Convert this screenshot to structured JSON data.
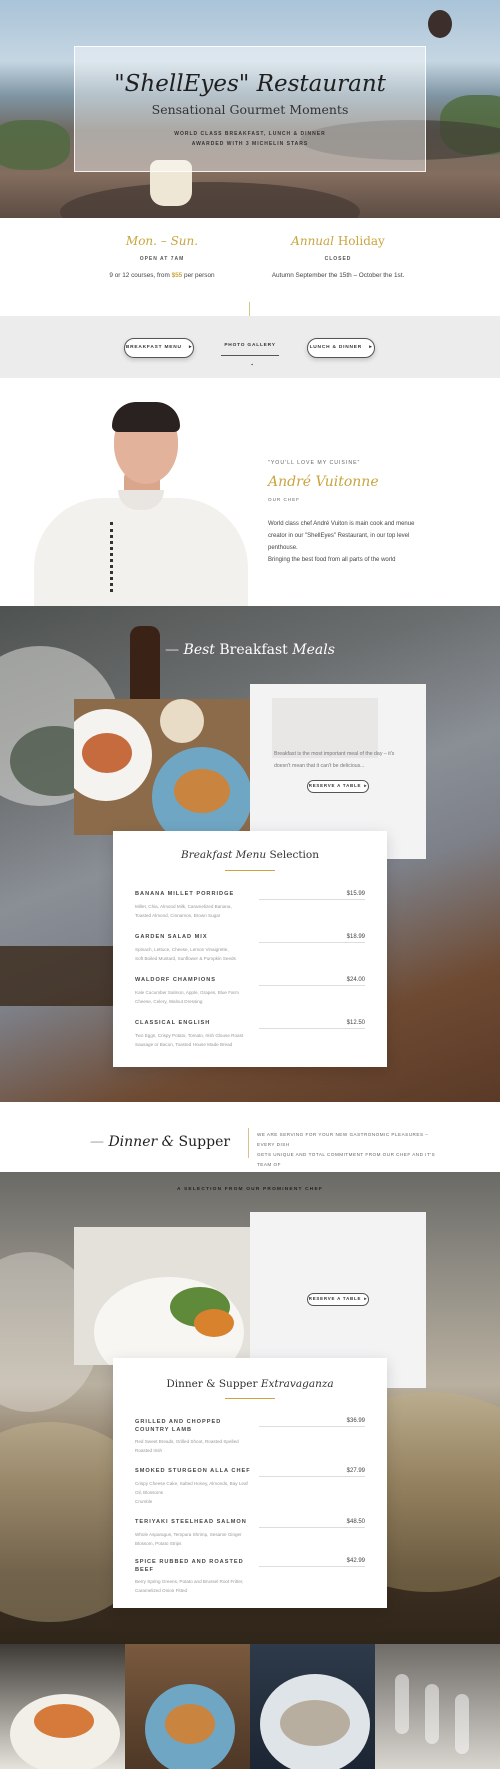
{
  "hero": {
    "title": "\"ShellEyes\" Restaurant",
    "subtitle": "Sensational Gourmet Moments",
    "line1": "WORLD CLASS BREAKFAST, LUNCH & DINNER",
    "line2": "AWARDED WITH 3 MICHELIN STARS"
  },
  "hours": {
    "left": {
      "title": "Mon. – Sun.",
      "caption": "OPEN AT 7AM",
      "text_pre": "9 or 12 courses, from ",
      "price": "$55",
      "text_post": " per person"
    },
    "right": {
      "title_italic": "Annual",
      "title_rest": " Holiday",
      "caption": "CLOSED",
      "text": "Autumn September the 15th – October the 1st."
    }
  },
  "nav_buttons": {
    "breakfast": "BREAKFAST MENU",
    "breakfast_icon": "▸",
    "gallery": "PHOTO GALLERY",
    "gallery_icon": "▪",
    "lunch": "LUNCH & DINNER",
    "lunch_icon": "▸"
  },
  "chef": {
    "quote": "\"YOU'LL LOVE MY CUISINE\"",
    "name": "André Vuitonne",
    "role": "OUR CHEF",
    "bio1": "World class chef André Vuiton is main cook and menue",
    "bio2": "creator in our \"ShellEyes\" Restaurant, in our top level",
    "bio3": "penthouse.",
    "bio4": "Bringing the best food from all parts of the world"
  },
  "breakfast": {
    "heading_italic": "Best",
    "heading_mid": " Breakfast ",
    "heading_italic2": "Meals",
    "intro1": "Breakfast is the most important meal of the day – it's",
    "intro2": "doesn't mean that it can't be delicious...",
    "reserve": "RESERVE A TABLE",
    "menu_title_italic": "Breakfast Menu",
    "menu_title_rest": " Selection",
    "items": [
      {
        "name": "BANANA MILLET PORRIDGE",
        "price": "$15.99",
        "desc1": "Millet, Chia, Almond Milk, Caramelized Banana,",
        "desc2": "Toasted Almond, Cinnamon, Brown Sugar"
      },
      {
        "name": "GARDEN SALAD MIX",
        "price": "$18.99",
        "desc1": "Spinach, Lettuce, Cheese, Lemon Vinaigrette,",
        "desc2": "Soft Boiled Mustard, Sunflower & Pumpkin Seeds"
      },
      {
        "name": "WALDORF CHAMPIONS",
        "price": "$24.00",
        "desc1": "Kale Cucumber Salmon, Apple, Grapes, Blue Farm",
        "desc2": "Cheese, Celery, Walnut Dressing"
      },
      {
        "name": "CLASSICAL ENGLISH",
        "price": "$12.50",
        "desc1": "Two Eggs, Crispy Potato, Tomato, Irish Glouse Roast",
        "desc2": "Sausage or Bacon, Toasted House Made Bread"
      }
    ]
  },
  "dinner": {
    "heading_italic": "Dinner",
    "heading_amp": " & ",
    "heading_rest": "Supper",
    "intro1": "WE ARE SERVING FOR YOUR NEW GASTRONOMIC PLEASURES – EVERY DISH",
    "intro2": "GETS UNIQUE AND TOTAL COMMITMENT FROM OUR CHEF AND IT'S TEAM OF",
    "intro3": "COOKS.",
    "selection": "A SELECTION FROM OUR PROMINENT CHEF",
    "reserve": "RESERVE A TABLE",
    "menu_title": "Dinner & Supper ",
    "menu_title_italic": "Extravaganza",
    "items": [
      {
        "name1": "GRILLED AND CHOPPED",
        "name2": "COUNTRY LAMB",
        "price": "$36.99",
        "desc1": "Red Sweet Breads, Grilled Shoot, Roasted Spelled",
        "desc2": "Roasted Irish"
      },
      {
        "name1": "SMOKED STURGEON ALLA CHEF",
        "name2": "",
        "price": "$27.99",
        "desc1": "Crispy Cheese Cake, Salted Honey, Almonds, Bay Leaf",
        "desc2": "Oil, Blossoms",
        "desc3": "Crumble"
      },
      {
        "name1": "TERIYAKI STEELHEAD SALMON",
        "name2": "",
        "price": "$48.50",
        "desc1": "Whole Asparagus, Tempura Shrimp, Sesame Ginger",
        "desc2": "Blossom, Potato Strips"
      },
      {
        "name1": "SPICE RUBBED AND ROASTED",
        "name2": "BEEF",
        "price": "$42.99",
        "desc1": "Berry Spring Greens, Potato and Brussel Root Fritter,",
        "desc2": "Caramelized Onion Fitted"
      }
    ]
  },
  "colors": {
    "gold": "#c9a53f",
    "text": "#444444",
    "bar_bg": "#ececec"
  }
}
